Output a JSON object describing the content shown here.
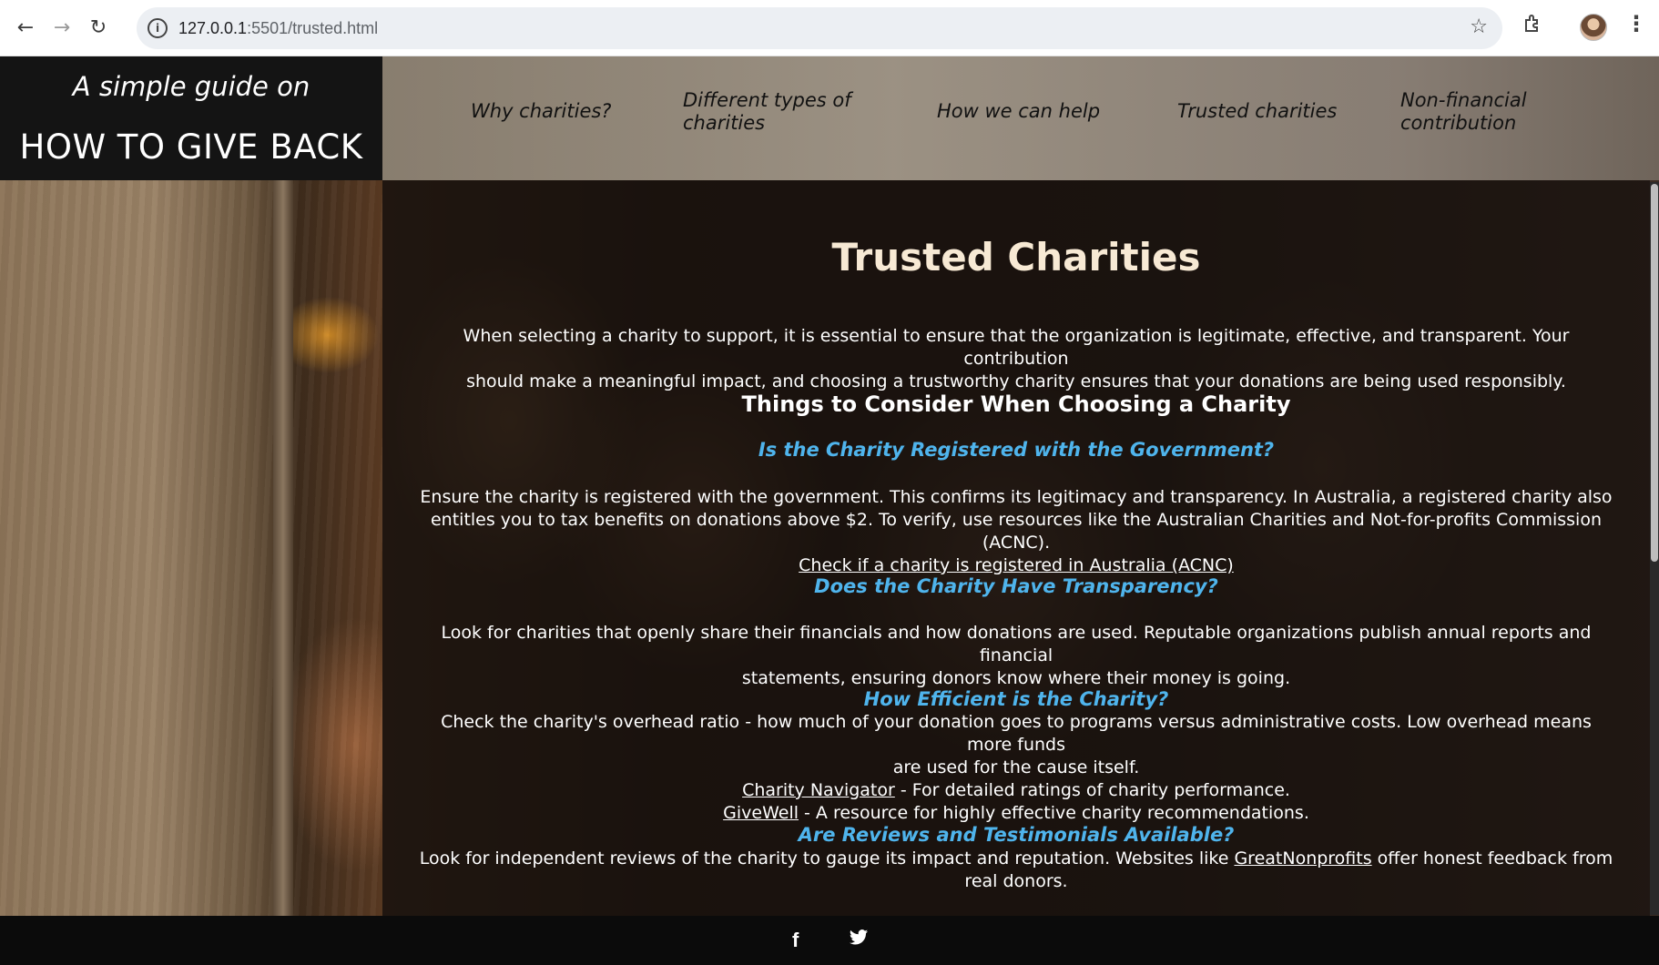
{
  "browser": {
    "url_host": "127.0.0.1",
    "url_rest": ":5501/trusted.html"
  },
  "brand": {
    "tagline": "A simple guide on",
    "title": "HOW TO GIVE BACK"
  },
  "nav": {
    "why": "Why charities?",
    "types_line1": "Different types of",
    "types_line2": "charities",
    "help": "How we can help",
    "trusted": "Trusted charities",
    "nonfin_line1": "Non-financial",
    "nonfin_line2": "contribution"
  },
  "content": {
    "title": "Trusted Charities",
    "intro_line1": "When selecting a charity to support, it is essential to ensure that the organization is legitimate, effective, and transparent. Your contribution",
    "intro_line2": "should make a meaningful impact, and choosing a trustworthy charity ensures that your donations are being used responsibly.",
    "consider_heading": "Things to Consider When Choosing a Charity",
    "q1": "Is the Charity Registered with the Government?",
    "q1_line1": "Ensure the charity is registered with the government. This confirms its legitimacy and transparency. In Australia, a registered charity also",
    "q1_line2": "entitles you to tax benefits on donations above $2. To verify, use resources like the Australian Charities and Not-for-profits Commission (ACNC).",
    "q1_link": "Check if a charity is registered in Australia (ACNC)",
    "q2": "Does the Charity Have Transparency?",
    "q2_line1": "Look for charities that openly share their financials and how donations are used. Reputable organizations publish annual reports and financial",
    "q2_line2": "statements, ensuring donors know where their money is going.",
    "q3": "How Efficient is the Charity?",
    "q3_line1": "Check the charity's overhead ratio - how much of your donation goes to programs versus administrative costs. Low overhead means more funds",
    "q3_line2": "are used for the cause itself.",
    "q3_link1": "Charity Navigator",
    "q3_link1_desc": " - For detailed ratings of charity performance.",
    "q3_link2": "GiveWell",
    "q3_link2_desc": " - A resource for highly effective charity recommendations.",
    "q4": "Are Reviews and Testimonials Available?",
    "q4_line1_pre": "Look for independent reviews of the charity to gauge its impact and reputation. Websites like ",
    "q4_link": "GreatNonprofits",
    "q4_line1_post": " offer honest feedback from",
    "q4_line2": "real donors."
  },
  "footer": {
    "facebook": "f"
  }
}
